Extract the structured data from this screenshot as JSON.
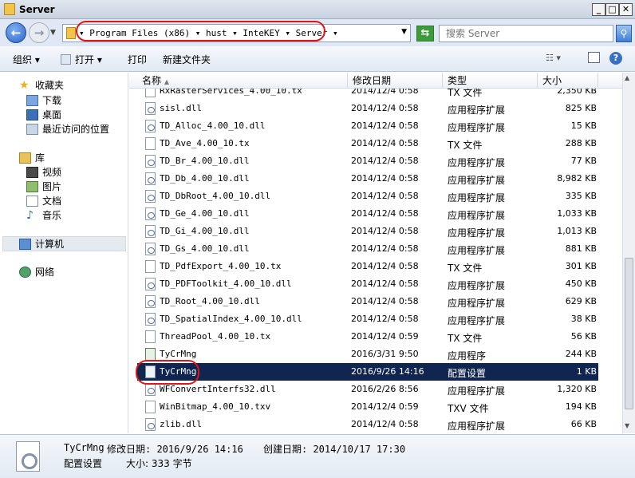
{
  "window": {
    "title": "Server"
  },
  "address": {
    "crumbs": [
      "Program Files (x86)",
      "hust",
      "InteKEY",
      "Server"
    ],
    "search_placeholder": "搜索 Server"
  },
  "toolbar": {
    "organize": "组织 ▾",
    "open": "打开 ▾",
    "print": "打印",
    "new_folder": "新建文件夹"
  },
  "nav": {
    "favorites": "收藏夹",
    "downloads": "下载",
    "desktop": "桌面",
    "recent": "最近访问的位置",
    "libraries": "库",
    "videos": "视频",
    "pictures": "图片",
    "documents": "文档",
    "music": "音乐",
    "computer": "计算机",
    "network": "网络"
  },
  "columns": {
    "name": "名称",
    "date": "修改日期",
    "type": "类型",
    "size": "大小"
  },
  "files": [
    {
      "name": "RxRasterServices_4.00_10.tx",
      "date": "2014/12/4 0:58",
      "type": "TX 文件",
      "size": "2,350 KB",
      "icon": "blank"
    },
    {
      "name": "sisl.dll",
      "date": "2014/12/4 0:58",
      "type": "应用程序扩展",
      "size": "825 KB",
      "icon": "dll"
    },
    {
      "name": "TD_Alloc_4.00_10.dll",
      "date": "2014/12/4 0:58",
      "type": "应用程序扩展",
      "size": "15 KB",
      "icon": "dll"
    },
    {
      "name": "TD_Ave_4.00_10.tx",
      "date": "2014/12/4 0:58",
      "type": "TX 文件",
      "size": "288 KB",
      "icon": "blank"
    },
    {
      "name": "TD_Br_4.00_10.dll",
      "date": "2014/12/4 0:58",
      "type": "应用程序扩展",
      "size": "77 KB",
      "icon": "dll"
    },
    {
      "name": "TD_Db_4.00_10.dll",
      "date": "2014/12/4 0:58",
      "type": "应用程序扩展",
      "size": "8,982 KB",
      "icon": "dll"
    },
    {
      "name": "TD_DbRoot_4.00_10.dll",
      "date": "2014/12/4 0:58",
      "type": "应用程序扩展",
      "size": "335 KB",
      "icon": "dll"
    },
    {
      "name": "TD_Ge_4.00_10.dll",
      "date": "2014/12/4 0:58",
      "type": "应用程序扩展",
      "size": "1,033 KB",
      "icon": "dll"
    },
    {
      "name": "TD_Gi_4.00_10.dll",
      "date": "2014/12/4 0:58",
      "type": "应用程序扩展",
      "size": "1,013 KB",
      "icon": "dll"
    },
    {
      "name": "TD_Gs_4.00_10.dll",
      "date": "2014/12/4 0:58",
      "type": "应用程序扩展",
      "size": "881 KB",
      "icon": "dll"
    },
    {
      "name": "TD_PdfExport_4.00_10.tx",
      "date": "2014/12/4 0:58",
      "type": "TX 文件",
      "size": "301 KB",
      "icon": "blank"
    },
    {
      "name": "TD_PDFToolkit_4.00_10.dll",
      "date": "2014/12/4 0:58",
      "type": "应用程序扩展",
      "size": "450 KB",
      "icon": "dll"
    },
    {
      "name": "TD_Root_4.00_10.dll",
      "date": "2014/12/4 0:58",
      "type": "应用程序扩展",
      "size": "629 KB",
      "icon": "dll"
    },
    {
      "name": "TD_SpatialIndex_4.00_10.dll",
      "date": "2014/12/4 0:58",
      "type": "应用程序扩展",
      "size": "38 KB",
      "icon": "dll"
    },
    {
      "name": "ThreadPool_4.00_10.tx",
      "date": "2014/12/4 0:59",
      "type": "TX 文件",
      "size": "56 KB",
      "icon": "blank"
    },
    {
      "name": "TyCrMng",
      "date": "2016/3/31 9:50",
      "type": "应用程序",
      "size": "244 KB",
      "icon": "exe"
    },
    {
      "name": "TyCrMng",
      "date": "2016/9/26 14:16",
      "type": "配置设置",
      "size": "1 KB",
      "icon": "ini",
      "selected": true
    },
    {
      "name": "WFConvertInterfs32.dll",
      "date": "2016/2/26 8:56",
      "type": "应用程序扩展",
      "size": "1,320 KB",
      "icon": "dll"
    },
    {
      "name": "WinBitmap_4.00_10.txv",
      "date": "2014/12/4 0:59",
      "type": "TXV 文件",
      "size": "194 KB",
      "icon": "blank"
    },
    {
      "name": "zlib.dll",
      "date": "2014/12/4 0:58",
      "type": "应用程序扩展",
      "size": "66 KB",
      "icon": "dll"
    }
  ],
  "details": {
    "name": "TyCrMng",
    "modified_label": "修改日期: 2016/9/26 14:16",
    "created_label": "创建日期: 2014/10/17 17:30",
    "type": "配置设置",
    "size_label": "大小: 333 字节"
  }
}
